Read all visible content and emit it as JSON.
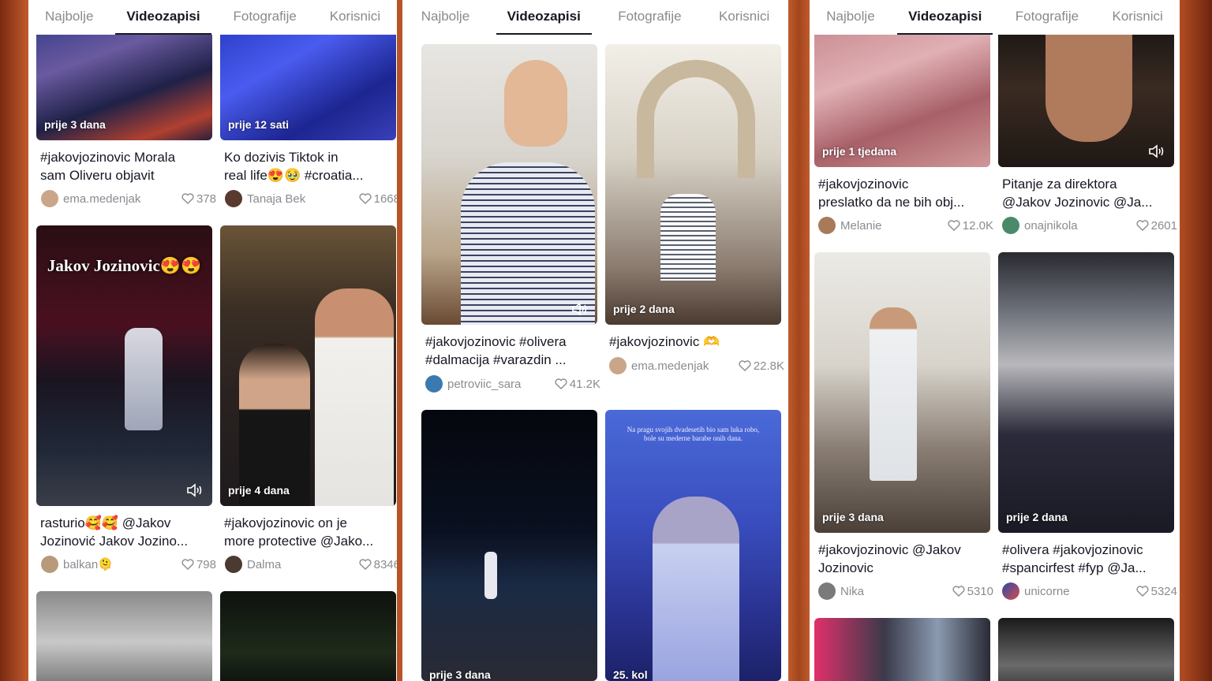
{
  "tabs": [
    "Najbolje",
    "Videozapisi",
    "Fotografije",
    "Korisnici"
  ],
  "active_tab_index": 1,
  "panels": [
    {
      "cards": [
        {
          "time": "prije 3 dana",
          "desc1": "#jakovjozinovic Morala",
          "desc2": "sam Oliveru objavit",
          "user": "ema.medenjak",
          "likes": "378"
        },
        {
          "time": "prije 12 sati",
          "desc1": "Ko dozivis Tiktok in",
          "desc2": "real life😍🥹 #croatia...",
          "user": "Tanaja Bek",
          "likes": "1668"
        },
        {
          "time": "",
          "overlay": "Jakov Jozinovic😍😍",
          "desc1": "rasturio🥰🥰 @Jakov",
          "desc2": "Jozinović Jakov Jozino...",
          "user": "balkan🫠",
          "likes": "798"
        },
        {
          "time": "prije 4 dana",
          "desc1": "#jakovjozinovic on je",
          "desc2": "more protective @Jako...",
          "user": "Dalma",
          "likes": "8346"
        }
      ]
    },
    {
      "cards": [
        {
          "time": "",
          "desc1": "#jakovjozinovic #olivera",
          "desc2": "#dalmacija #varazdin ...",
          "user": "petroviic_sara",
          "likes": "41.2K"
        },
        {
          "time": "prije 2 dana",
          "desc1": "#jakovjozinovic 🫶",
          "desc2": "",
          "user": "ema.medenjak",
          "likes": "22.8K"
        },
        {
          "time": "prije 3 dana"
        },
        {
          "time": "25. kol",
          "caption": "Na pragu svojih dvadesetih bio sam luka robo, bole su mederne barabe onih dana."
        }
      ]
    },
    {
      "cards": [
        {
          "time": "prije 1 tjedana",
          "desc1": "#jakovjozinovic",
          "desc2": "preslatko da ne bih obj...",
          "user": "Melanie",
          "likes": "12.0K"
        },
        {
          "time": "",
          "desc1": "Pitanje za direktora",
          "desc2": "@Jakov Jozinovic @Ja...",
          "user": "onajnikola",
          "likes": "2601"
        },
        {
          "time": "prije 3 dana",
          "desc1": "#jakovjozinovic @Jakov",
          "desc2": "Jozinovic",
          "user": "Nika",
          "likes": "5310"
        },
        {
          "time": "prije 2 dana",
          "desc1": "#olivera #jakovjozinovic",
          "desc2": "#spancirfest #fyp @Ja...",
          "user": "unicorne",
          "likes": "5324"
        }
      ]
    }
  ],
  "colors": {
    "text": "#161823",
    "muted": "#8a8b91",
    "background_accent": "#b8542a"
  }
}
